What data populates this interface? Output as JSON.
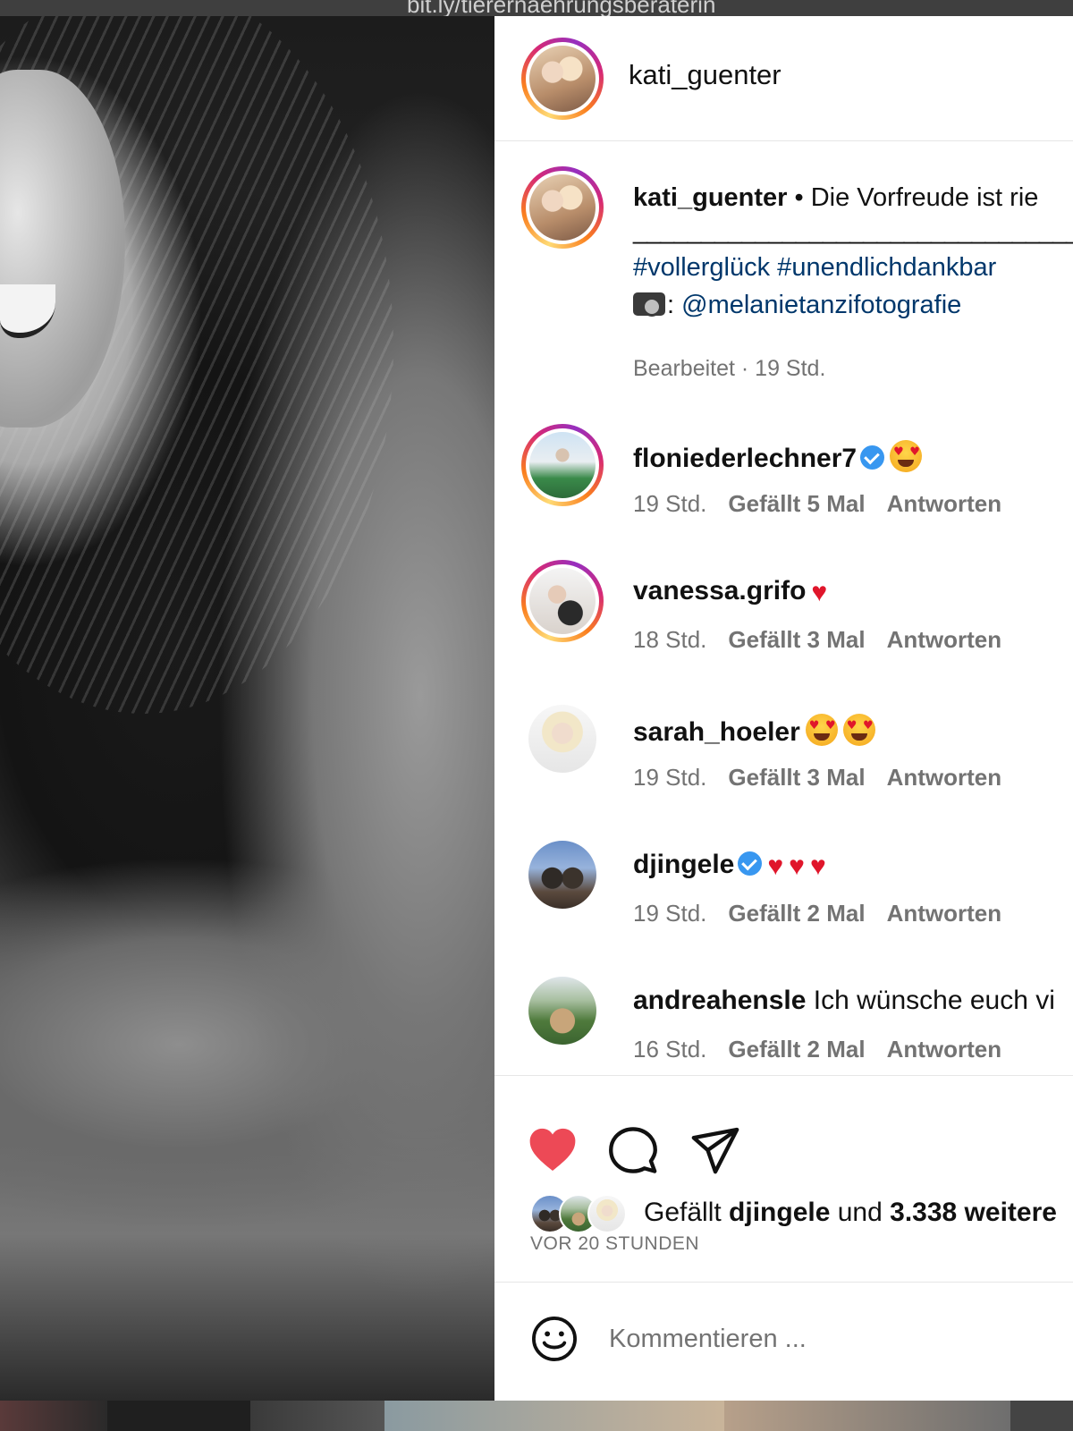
{
  "browser": {
    "url": "bit.ly/tierernaehrungsberaterin"
  },
  "post": {
    "author": "kati_guenter",
    "caption": {
      "username": "kati_guenter",
      "separator": " • ",
      "text": "Die Vorfreude ist rie",
      "divider": "_________________________________",
      "hashtags": "#vollerglück #unendlichdankbar",
      "photo_credit_prefix": ": ",
      "photo_credit": "@melanietanzifotografie",
      "meta": "Bearbeitet · 19 Std."
    },
    "comments": [
      {
        "username": "floniederlechner7",
        "verified": true,
        "text": "",
        "emoji": "heart-eyes",
        "time": "19 Std.",
        "likes": "Gefällt 5 Mal",
        "reply": "Antworten"
      },
      {
        "username": "vanessa.grifo",
        "verified": false,
        "text": "",
        "emoji": "heart",
        "time": "18 Std.",
        "likes": "Gefällt 3 Mal",
        "reply": "Antworten"
      },
      {
        "username": "sarah_hoeler",
        "verified": false,
        "text": "",
        "emoji": "heart-eyes x2",
        "time": "19 Std.",
        "likes": "Gefällt 3 Mal",
        "reply": "Antworten"
      },
      {
        "username": "djingele",
        "verified": true,
        "text": "",
        "emoji": "heart x3",
        "time": "19 Std.",
        "likes": "Gefällt 2 Mal",
        "reply": "Antworten"
      },
      {
        "username": "andreahensle",
        "verified": false,
        "text": " Ich wünsche euch vi",
        "emoji": "",
        "time": "16 Std.",
        "likes": "Gefällt 2 Mal",
        "reply": "Antworten"
      }
    ],
    "likes": {
      "prefix": "Gefällt ",
      "liker": "djingele",
      "middle": " und ",
      "count": "3.338 weitere"
    },
    "time_ago": "VOR 20 STUNDEN",
    "comment_input": {
      "placeholder": "Kommentieren ..."
    },
    "colors": {
      "like_red": "#ed4956",
      "link_blue": "#00376b",
      "meta_gray": "#737373",
      "verified_blue": "#3897f0"
    },
    "icons": {
      "like": "heart-filled-icon",
      "comment": "speech-bubble-icon",
      "share": "paper-plane-icon",
      "emoji": "smiley-icon"
    }
  }
}
